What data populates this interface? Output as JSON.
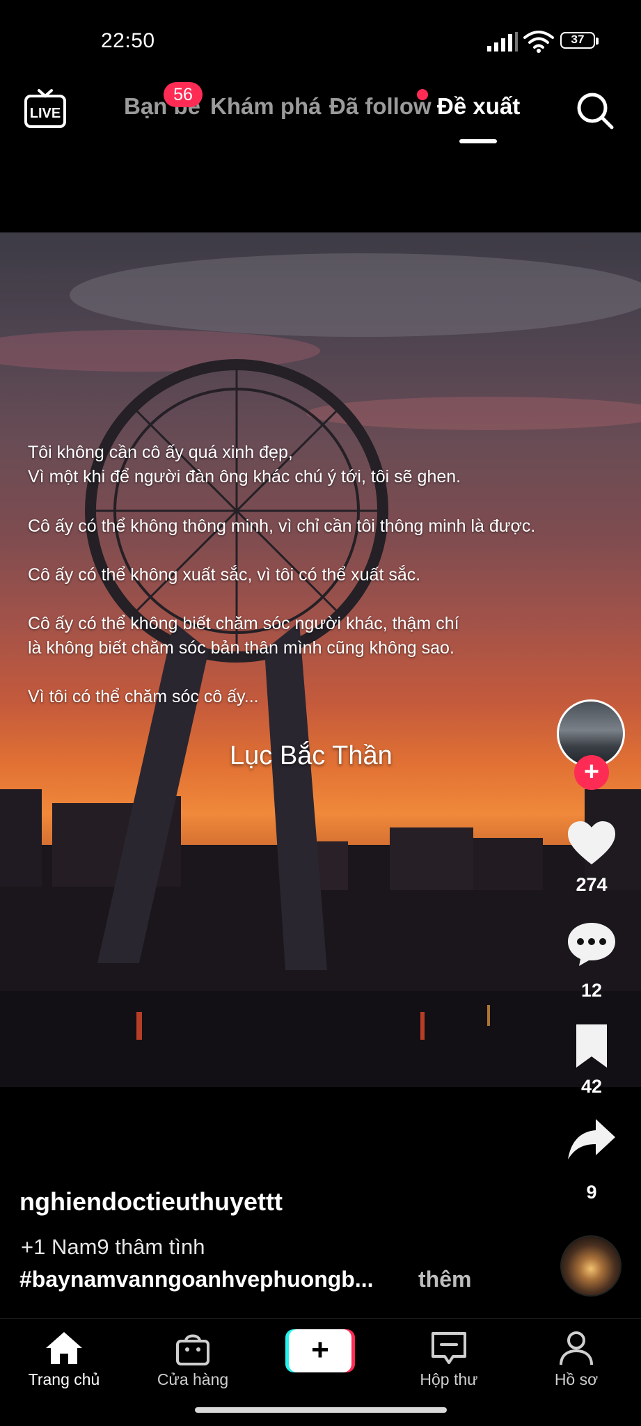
{
  "status_bar": {
    "time": "22:50",
    "battery": "37"
  },
  "top_nav": {
    "live_label": "LIVE",
    "tabs": [
      {
        "label": "Bạn bè",
        "badge": "56"
      },
      {
        "label": "Khám phá"
      },
      {
        "label": "Đã follow",
        "dot": true
      },
      {
        "label": "Đề xuất",
        "active": true
      }
    ]
  },
  "video": {
    "poem_lines": [
      "Tôi không cần cô ấy quá xinh đẹp,",
      "Vì một khi để người đàn ông khác chú ý tới, tôi sẽ ghen.",
      "Cô ấy có thể không thông minh, vì chỉ cần tôi thông minh là được.",
      "Cô ấy có thể không xuất sắc, vì tôi có thể xuất sắc.",
      "Cô ấy có thể không biết chăm sóc người khác, thậm chí",
      "là không biết chăm sóc bản thân mình cũng không sao.",
      "Vì tôi có thể chăm sóc cô ấy..."
    ],
    "signature": "Lục Bắc Thần"
  },
  "actions": {
    "follow_symbol": "+",
    "likes": "274",
    "comments": "12",
    "saves": "42",
    "shares": "9"
  },
  "caption": {
    "username": "nghiendoctieuthuyettt",
    "line1": "+1 Nam9 thâm tình",
    "hashtags": "#baynamvanngoanhvephuongb...",
    "more": "thêm"
  },
  "bottom_nav": {
    "items": [
      {
        "label": "Trang chủ",
        "icon": "home-icon"
      },
      {
        "label": "Cửa hàng",
        "icon": "shop-icon"
      },
      {
        "label": "+",
        "icon": "plus-icon"
      },
      {
        "label": "Hộp thư",
        "icon": "inbox-icon"
      },
      {
        "label": "Hồ sơ",
        "icon": "profile-icon"
      }
    ]
  },
  "colors": {
    "accent": "#fe2c55",
    "cyan": "#25f4ee",
    "background": "#000000"
  }
}
